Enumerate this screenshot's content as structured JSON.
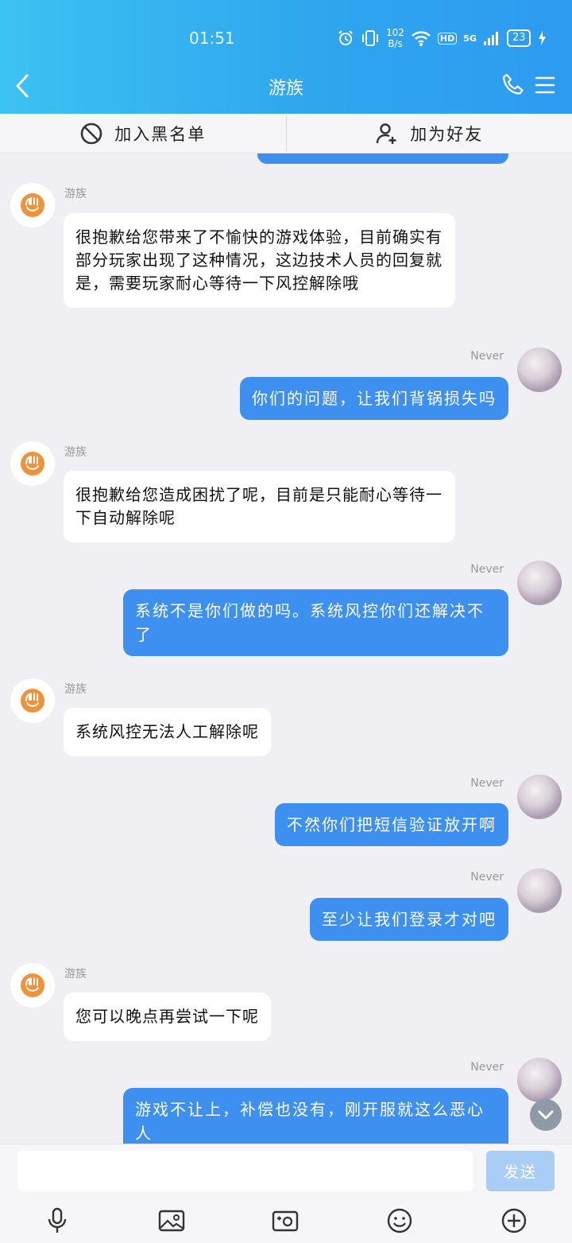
{
  "status": {
    "time": "01:51",
    "speed_top": "102",
    "speed_unit": "B/s",
    "network": "5G",
    "hd": "HD",
    "battery": "23"
  },
  "nav": {
    "title": "游族",
    "back_icon": "chevron-left-icon",
    "call_icon": "phone-icon",
    "menu_icon": "menu-icon"
  },
  "actions": {
    "block_label": "加入黑名单",
    "add_friend_label": "加为好友"
  },
  "messages": [
    {
      "side": "left",
      "name": "游族",
      "text": "很抱歉给您带来了不愉快的游戏体验，目前确实有部分玩家出现了这种情况，这边技术人员的回复就是，需要玩家耐心等待一下风控解除哦"
    },
    {
      "side": "right",
      "name": "Never",
      "text": "你们的问题，让我们背锅损失吗"
    },
    {
      "side": "left",
      "name": "游族",
      "text": "很抱歉给您造成困扰了呢，目前是只能耐心等待一下自动解除呢"
    },
    {
      "side": "right",
      "name": "Never",
      "text": "系统不是你们做的吗。系统风控你们还解决不了"
    },
    {
      "side": "left",
      "name": "游族",
      "text": "系统风控无法人工解除呢"
    },
    {
      "side": "right",
      "name": "Never",
      "text": "不然你们把短信验证放开啊"
    },
    {
      "side": "right",
      "name": "Never",
      "text": "至少让我们登录才对吧"
    },
    {
      "side": "left",
      "name": "游族",
      "text": "您可以晚点再尝试一下呢"
    },
    {
      "side": "right",
      "name": "Never",
      "text": "游戏不让上，补偿也没有，刚开服就这么恶心人"
    }
  ],
  "input": {
    "placeholder": "",
    "value": "",
    "send_label": "发送"
  },
  "toolbar": [
    "microphone-icon",
    "image-icon",
    "camera-icon",
    "emoji-icon",
    "plus-icon"
  ],
  "colors": {
    "header": "#2fa6ee",
    "bubble_self": "#3d8ff0",
    "logo": "#f0923a"
  }
}
